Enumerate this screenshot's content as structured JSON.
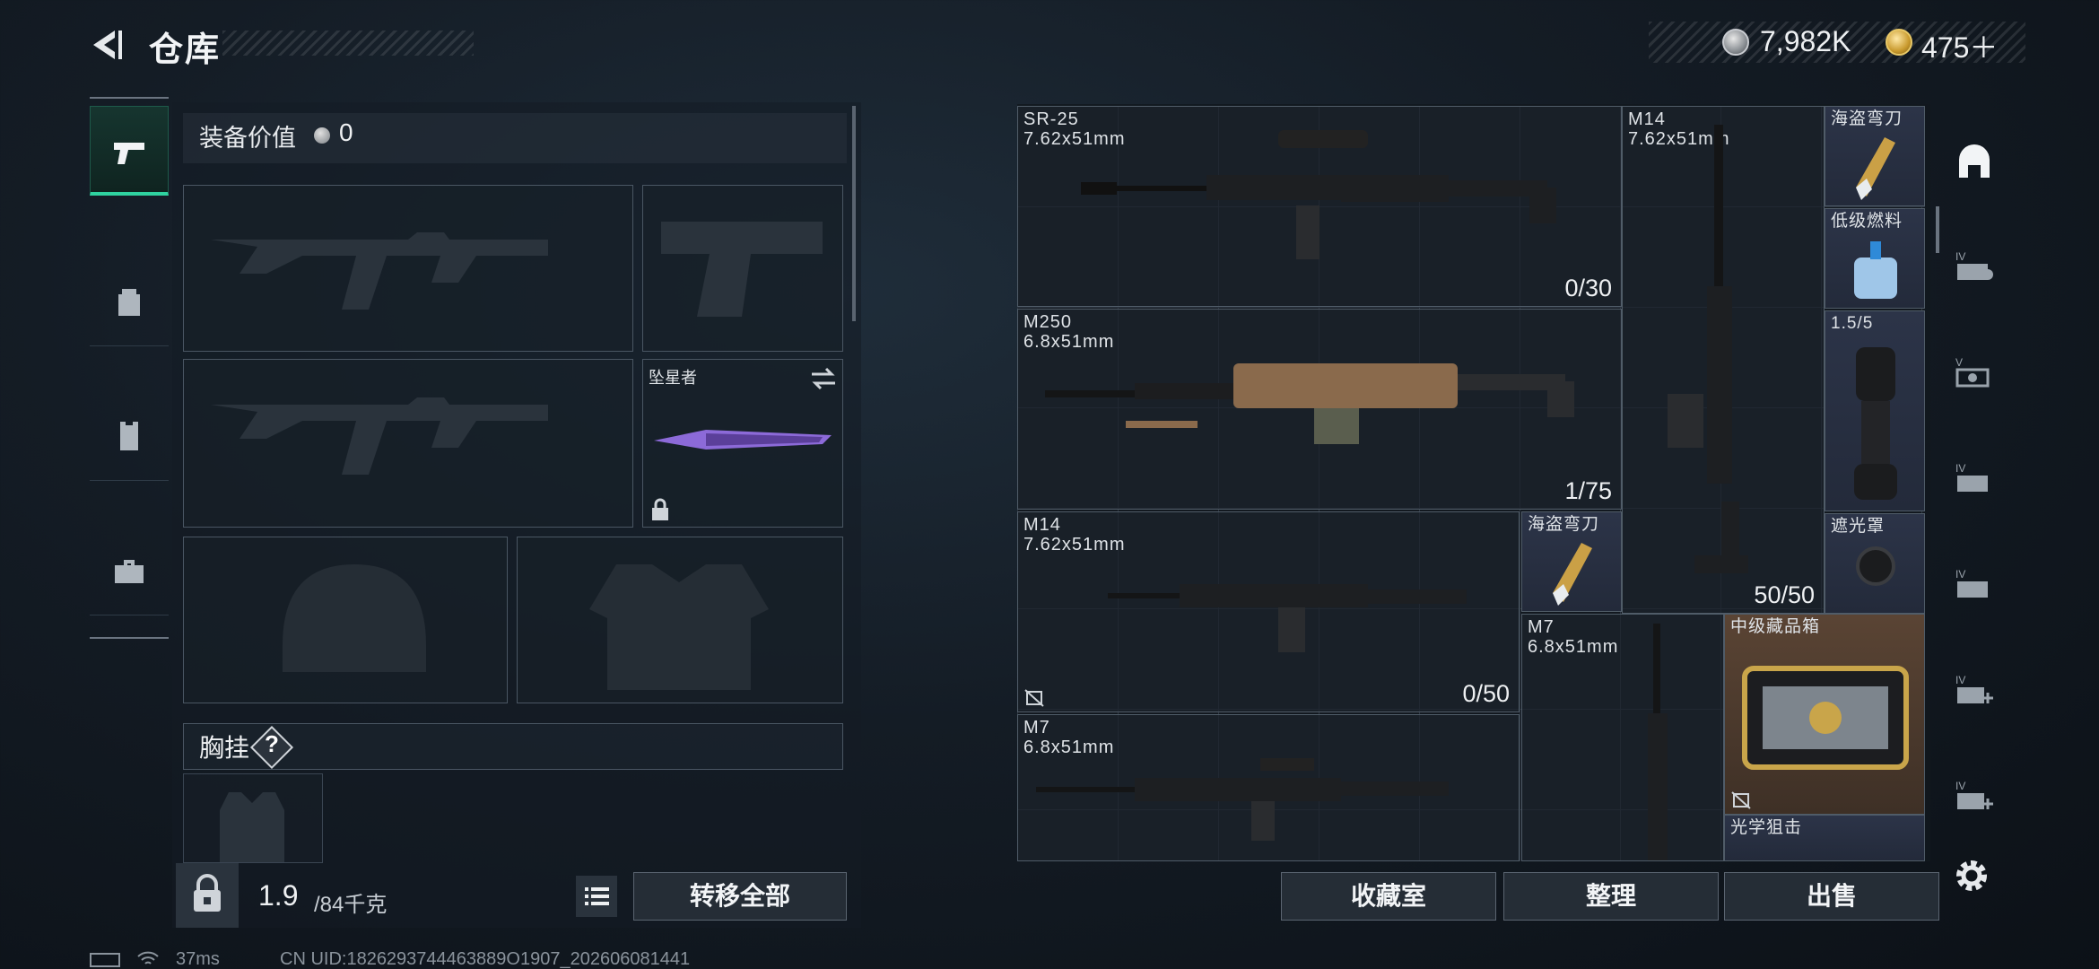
{
  "header": {
    "title": "仓库",
    "currency": [
      {
        "icon": "silver-coin-icon",
        "value": "7,982K"
      },
      {
        "icon": "gold-coin-icon",
        "value": "475＋"
      }
    ]
  },
  "left_rail": [
    {
      "icon": "pistol-icon",
      "active": true
    },
    {
      "icon": "backpack-icon",
      "active": false
    },
    {
      "icon": "vest-icon",
      "active": false
    },
    {
      "icon": "briefcase-icon",
      "active": false
    }
  ],
  "loadout": {
    "equip_label": "装备价值",
    "equip_value": "0",
    "melee_name": "坠星者",
    "chest_label": "胸挂",
    "chest_help": "?",
    "weight_value": "1.9",
    "weight_unit": "/84千克",
    "transfer_label": "转移全部"
  },
  "stash": {
    "items": [
      {
        "name": "SR-25",
        "ammo": "7.62x51mm",
        "count": "0/30"
      },
      {
        "name": "M250",
        "ammo": "6.8x51mm",
        "count": "1/75"
      },
      {
        "name": "M14",
        "ammo": "7.62x51mm",
        "count": "0/50"
      },
      {
        "name": "M7",
        "ammo": "6.8x51mm",
        "count": ""
      },
      {
        "name": "M14",
        "ammo": "7.62x51mm",
        "count": "50/50"
      },
      {
        "name": "M7",
        "ammo": "6.8x51mm",
        "count": ""
      }
    ],
    "small_items": [
      {
        "name": "海盗弯刀"
      },
      {
        "name": "低级燃料"
      },
      {
        "name": "1.5/5"
      },
      {
        "name": "遮光罩"
      },
      {
        "name": "海盗弯刀"
      },
      {
        "name": "中级藏品箱"
      },
      {
        "name": "光学狙击"
      }
    ],
    "buttons": {
      "collection": "收藏室",
      "organize": "整理",
      "sell": "出售"
    }
  },
  "right_tabs": [
    {
      "icon": "stash-home-icon"
    },
    {
      "icon": "stash-tab-iv-add-icon"
    },
    {
      "icon": "stash-tab-v-camera-icon"
    },
    {
      "icon": "stash-tab-iv-folder-icon"
    },
    {
      "icon": "stash-tab-iv-folder-icon"
    },
    {
      "icon": "stash-tab-iv-plus-icon"
    },
    {
      "icon": "stash-tab-iv-plus-icon"
    }
  ],
  "status_bar": {
    "ping": "37ms",
    "uid": "CN UID:1826293744463889O1907_202606081441"
  },
  "colors": {
    "accent": "#2fd3a0",
    "small_item_bg": "#2c3448",
    "box_item_bg": "#5a4434"
  }
}
